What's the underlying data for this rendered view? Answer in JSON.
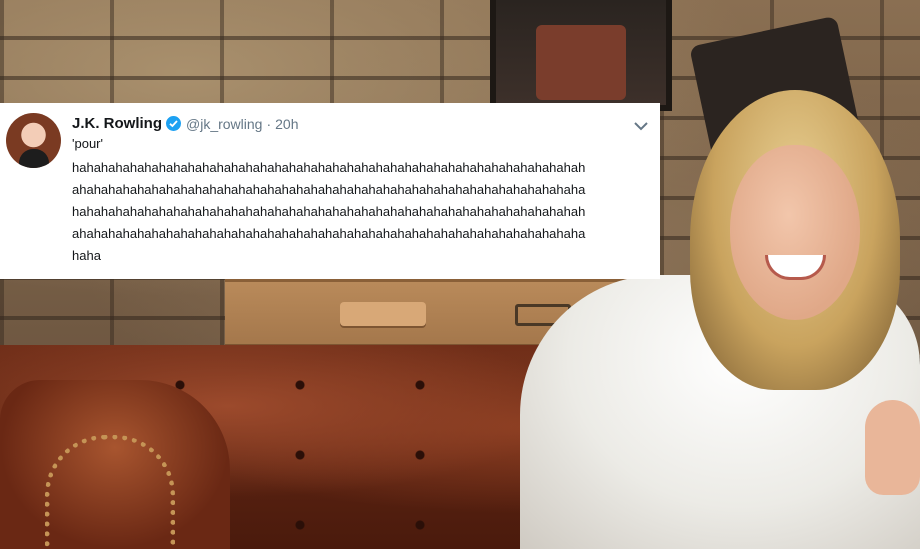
{
  "tweet": {
    "display_name": "J.K. Rowling",
    "handle": "@jk_rowling",
    "separator": "·",
    "time": "20h",
    "quote": "'pour'",
    "lines": [
      "hahahahahahahahahahahahahahahahahahahahahahahahahahahahahahahahahahahah",
      "ahahahahahahahahahahahahahahahahahahahahahahahahahahahahahahahahahahaha",
      "hahahahahahahahahahahahahahahahahahahahahahahahahahahahahahahahahahahah",
      "ahahahahahahahahahahahahahahahahahahahahahahahahahahahahahahahahahahaha",
      "haha"
    ],
    "icons": {
      "verified": "verified-badge-icon",
      "menu": "chevron-down-icon"
    },
    "colors": {
      "verified": "#1da1f2",
      "muted_text": "#657786",
      "text": "#14171a"
    }
  }
}
